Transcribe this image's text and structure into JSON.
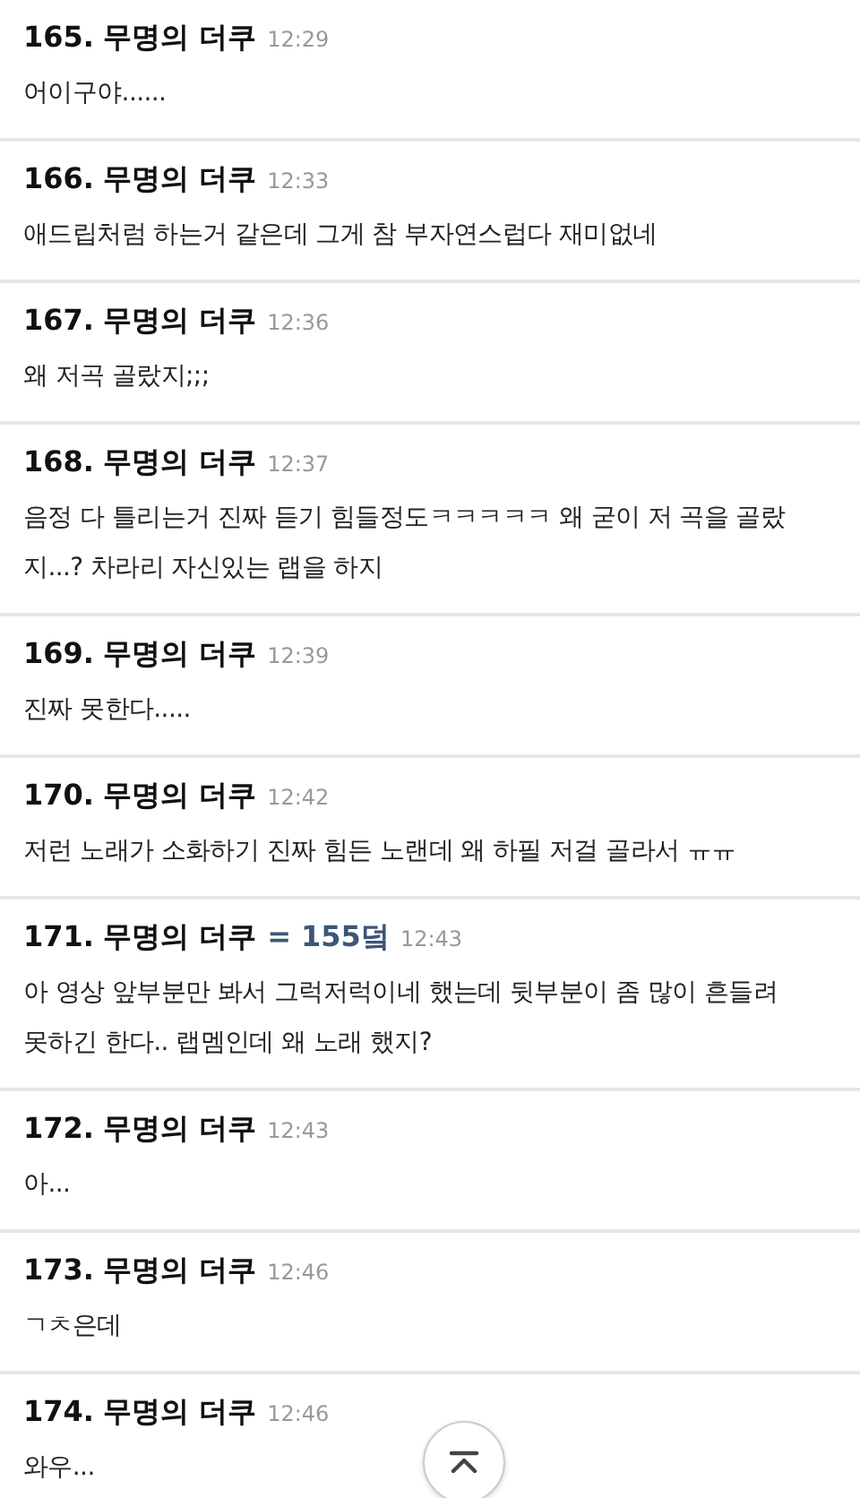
{
  "comments": [
    {
      "number": "165",
      "dot": ".",
      "author": "무명의 더쿠",
      "time": "12:29",
      "lines": [
        "어이구야......"
      ]
    },
    {
      "number": "166",
      "dot": ".",
      "author": "무명의 더쿠",
      "time": "12:33",
      "lines": [
        "애드립처럼 하는거 같은데 그게 참 부자연스럽다 재미없네"
      ]
    },
    {
      "number": "167",
      "dot": ".",
      "author": "무명의 더쿠",
      "time": "12:36",
      "lines": [
        "왜 저곡 골랐지;;;"
      ]
    },
    {
      "number": "168",
      "dot": ".",
      "author": "무명의 더쿠",
      "time": "12:37",
      "lines": [
        "음정 다 틀리는거 진짜 듣기 힘들정도ㅋㅋㅋㅋㅋ 왜 굳이 저 곡을 골랐",
        "지...? 차라리 자신있는 랩을 하지"
      ]
    },
    {
      "number": "169",
      "dot": ".",
      "author": "무명의 더쿠",
      "time": "12:39",
      "lines": [
        "진짜 못한다....."
      ]
    },
    {
      "number": "170",
      "dot": ".",
      "author": "무명의 더쿠",
      "time": "12:42",
      "lines": [
        "저런 노래가 소화하기 진짜 힘든 노랜데 왜 하필 저걸 골라서 ㅠㅠ"
      ]
    },
    {
      "number": "171",
      "dot": ".",
      "author": "무명의 더쿠",
      "reply": "= 155덬",
      "time": "12:43",
      "lines": [
        "아 영상 앞부분만 봐서 그럭저럭이네 했는데 뒷부분이 좀 많이 흔들려",
        "못하긴 한다.. 랩멤인데 왜 노래 했지?"
      ]
    },
    {
      "number": "172",
      "dot": ".",
      "author": "무명의 더쿠",
      "time": "12:43",
      "lines": [
        "아..."
      ]
    },
    {
      "number": "173",
      "dot": ".",
      "author": "무명의 더쿠",
      "time": "12:46",
      "lines": [
        "ㄱㅊ은데"
      ]
    },
    {
      "number": "174",
      "dot": ".",
      "author": "무명의 더쿠",
      "time": "12:46",
      "lines": [
        "와우..."
      ]
    }
  ],
  "scroll_top_button": {
    "kind": "to-top"
  }
}
